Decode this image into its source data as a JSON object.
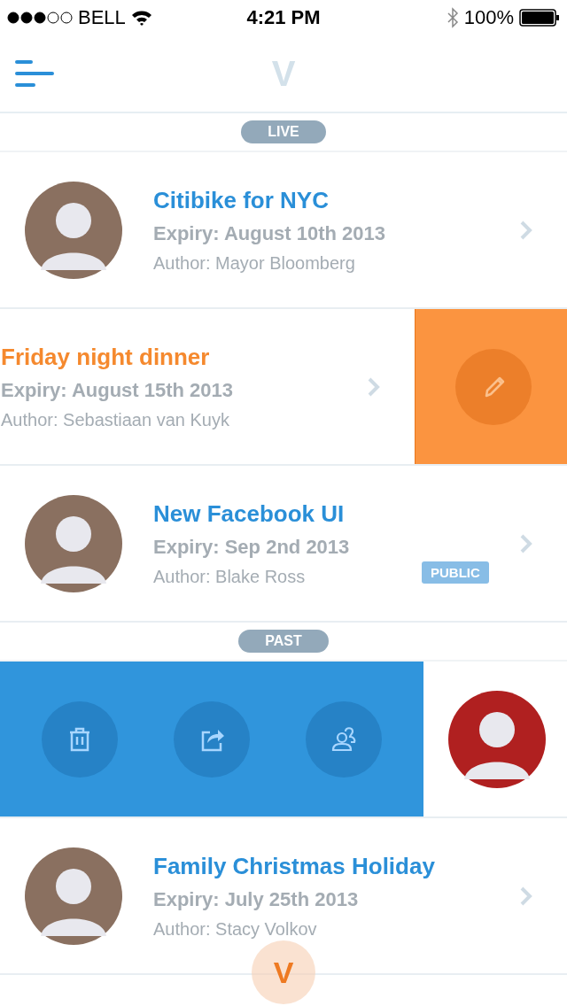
{
  "status_bar": {
    "carrier": "BELL",
    "time": "4:21 PM",
    "battery": "100%"
  },
  "nav_bar": {
    "logo": "V"
  },
  "sections": [
    {
      "label": "LIVE",
      "items": [
        {
          "kind": "normal",
          "title": "Citibike for NYC",
          "expiry": "Expiry: August 10th 2013",
          "author": "Author: Mayor Bloomberg"
        },
        {
          "kind": "actions_right",
          "title": "Friday night dinner",
          "expiry": "Expiry: August 15th 2013",
          "author": "Author: Sebastiaan van Kuyk",
          "actions": [
            {
              "kind": "edit"
            }
          ]
        },
        {
          "kind": "normal",
          "title": "New Facebook UI",
          "expiry": "Expiry: Sep 2nd 2013",
          "author": "Author: Blake Ross",
          "badge": "PUBLIC"
        }
      ]
    },
    {
      "label": "PAST",
      "items": [
        {
          "kind": "actions_left",
          "actions": [
            {
              "kind": "delete"
            },
            {
              "kind": "share"
            },
            {
              "kind": "people"
            }
          ]
        },
        {
          "kind": "normal",
          "title": "Family Christmas Holiday",
          "expiry": "Expiry: July 25th 2013",
          "author": "Author: Stacy Volkov"
        }
      ]
    }
  ],
  "fab": {
    "label": "V"
  }
}
